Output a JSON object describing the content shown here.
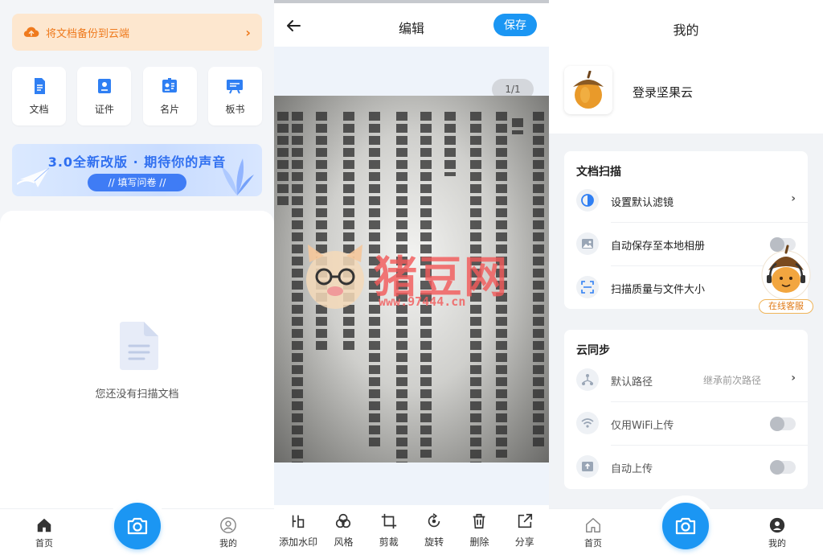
{
  "home": {
    "backup_text": "将文档备份到云端",
    "tiles": [
      {
        "label": "文档",
        "icon": "document-icon"
      },
      {
        "label": "证件",
        "icon": "id-card-icon"
      },
      {
        "label": "名片",
        "icon": "business-card-icon"
      },
      {
        "label": "板书",
        "icon": "blackboard-icon"
      }
    ],
    "banner_title": "3.0全新改版 · 期待你的声音",
    "banner_button": "// 填写问卷 //",
    "empty_text": "您还没有扫描文档",
    "tabbar": {
      "home": "首页",
      "mine": "我的"
    },
    "accent": "#1b96f3"
  },
  "editor": {
    "title": "编辑",
    "save_label": "保存",
    "page_indicator": "1/1",
    "watermark_text": "猪豆网",
    "watermark_url": "www.97444.cn",
    "tools": [
      {
        "label": "添加水印",
        "icon": "watermark-icon"
      },
      {
        "label": "风格",
        "icon": "style-icon"
      },
      {
        "label": "剪裁",
        "icon": "crop-icon"
      },
      {
        "label": "旋转",
        "icon": "rotate-icon"
      },
      {
        "label": "删除",
        "icon": "trash-icon"
      },
      {
        "label": "分享",
        "icon": "share-icon"
      }
    ]
  },
  "mine": {
    "title": "我的",
    "login_text": "登录坚果云",
    "scan_section": {
      "title": "文档扫描",
      "items": [
        {
          "label": "设置默认滤镜",
          "icon": "filter-icon",
          "control": "chevron"
        },
        {
          "label": "自动保存至本地相册",
          "icon": "image-icon",
          "control": "toggle",
          "on": false
        },
        {
          "label": "扫描质量与文件大小",
          "icon": "scan-frame-icon",
          "control": "chevron"
        }
      ]
    },
    "sync_section": {
      "title": "云同步",
      "items": [
        {
          "label": "默认路径",
          "value": "继承前次路径",
          "icon": "path-icon",
          "control": "chevron"
        },
        {
          "label": "仅用WiFi上传",
          "icon": "wifi-icon",
          "control": "toggle",
          "on": false
        },
        {
          "label": "自动上传",
          "icon": "upload-icon",
          "control": "toggle",
          "on": false
        }
      ]
    },
    "service_label": "在线客服",
    "tabbar": {
      "home": "首页",
      "mine": "我的"
    }
  }
}
